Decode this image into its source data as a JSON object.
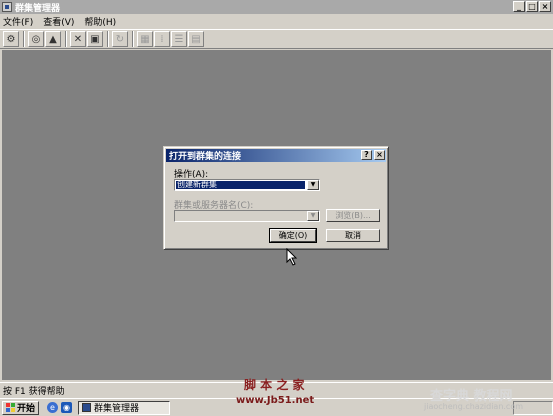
{
  "window": {
    "title": "群集管理器"
  },
  "menu": [
    "文件(F)",
    "查看(V)",
    "帮助(H)"
  ],
  "toolbar_icons": [
    "cluster-icon",
    "properties-icon",
    "up-icon",
    "delete-icon",
    "new-icon",
    "refresh-icon",
    "large-icons-icon",
    "small-icons-icon",
    "list-icon",
    "details-icon"
  ],
  "dialog": {
    "title": "打开到群集的连接",
    "action_label": "操作(A):",
    "action_value": "创建新群集",
    "name_label": "群集或服务器名(C):",
    "name_value": "",
    "browse_label": "浏览(B)...",
    "ok_label": "确定(O)",
    "cancel_label": "取消"
  },
  "status": {
    "text": "按 F1 获得帮助"
  },
  "taskbar": {
    "start_label": "开始",
    "task_label": "群集管理器"
  },
  "watermarks": {
    "left_line1": "脚 本 之 家",
    "left_line2": "www.Jb51.net",
    "right_line1": "查字典 教程网",
    "right_line2": "jiaocheng.chazidian.com"
  }
}
